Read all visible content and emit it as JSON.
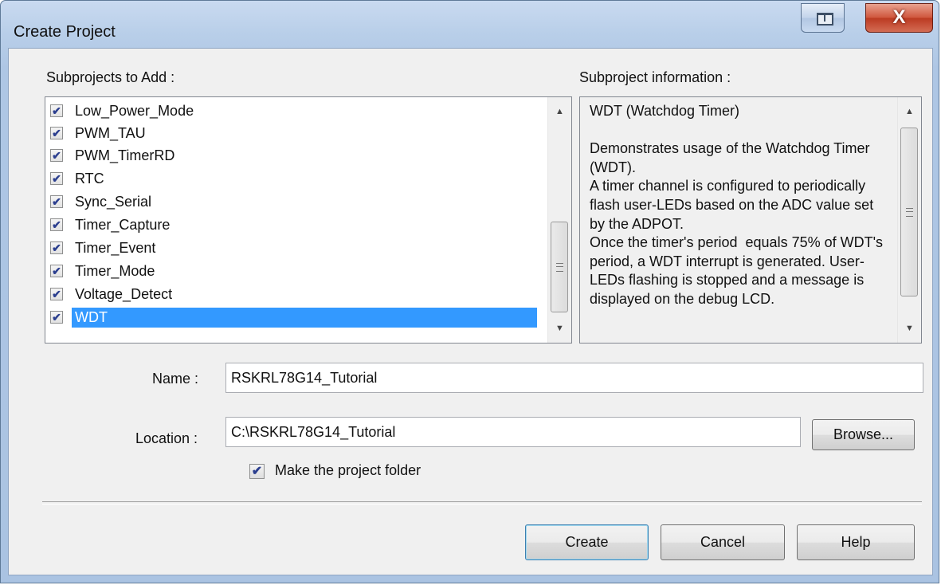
{
  "window": {
    "title": "Create Project",
    "close_glyph": "X"
  },
  "subprojects": {
    "label": "Subprojects to Add :",
    "items": [
      {
        "label": "Low_Power_Mode",
        "checked": true
      },
      {
        "label": "PWM_TAU",
        "checked": true
      },
      {
        "label": "PWM_TimerRD",
        "checked": true
      },
      {
        "label": "RTC",
        "checked": true
      },
      {
        "label": "Sync_Serial",
        "checked": true
      },
      {
        "label": "Timer_Capture",
        "checked": true
      },
      {
        "label": "Timer_Event",
        "checked": true
      },
      {
        "label": "Timer_Mode",
        "checked": true
      },
      {
        "label": "Voltage_Detect",
        "checked": true
      },
      {
        "label": "WDT",
        "checked": true,
        "selected": true
      }
    ],
    "check_glyph": "✔"
  },
  "info": {
    "label": "Subproject information :",
    "text": "WDT (Watchdog Timer)\n\nDemonstrates usage of the Watchdog Timer (WDT).\nA timer channel is configured to periodically flash user-LEDs based on the ADC value set by the ADPOT.\nOnce the timer's period  equals 75% of WDT's period, a WDT interrupt is generated. User-LEDs flashing is stopped and a message is displayed on the debug LCD."
  },
  "form": {
    "name_label": "Name :",
    "name_value": "RSKRL78G14_Tutorial",
    "location_label": "Location :",
    "location_value": "C:\\RSKRL78G14_Tutorial",
    "browse_label": "Browse...",
    "make_folder_label": "Make the project folder",
    "make_folder_checked": true
  },
  "buttons": {
    "create": "Create",
    "cancel": "Cancel",
    "help": "Help"
  },
  "scroll_glyphs": {
    "up": "▲",
    "down": "▼"
  }
}
